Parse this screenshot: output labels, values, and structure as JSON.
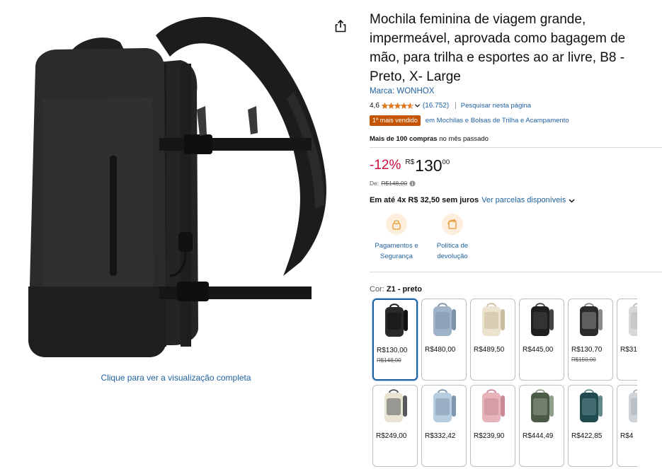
{
  "product": {
    "title": "Mochila feminina de viagem grande, impermeável, aprovada como bagagem de mão, para trilha e esportes ao ar livre, B8 - Preto, X- Large",
    "brand": "Marca: WONHOX",
    "image_alt": "Mochila de viagem preta",
    "view_full": "Clique para ver a visualização completa"
  },
  "rating": {
    "value": "4,6",
    "stars": 4.6,
    "count": "(16.752)",
    "separator": "|",
    "search_page": "Pesquisar nesta página"
  },
  "bestseller": {
    "badge": "1º mais vendido",
    "category": "em Mochilas e Bolsas de Trilha e Acampamento"
  },
  "bought": {
    "bold": "Mais de 100 compras",
    "rest": " no mês passado"
  },
  "price": {
    "discount": "-12%",
    "currency": "R$",
    "whole": "130",
    "cents": "00",
    "list_label": "De:",
    "list_price": "R$148,00"
  },
  "installments": {
    "bold": "Em até 4x R$ 32,50 sem juros",
    "link": "Ver parcelas disponíveis"
  },
  "features": [
    {
      "line1": "Pagamentos e",
      "line2": "Segurança"
    },
    {
      "line1": "Política de",
      "line2": "devolução"
    }
  ],
  "color": {
    "key": "Cor: ",
    "value": "Z1 - preto"
  },
  "swatches": [
    {
      "price": "R$130,00",
      "old": "R$148,00",
      "bag": "#2a2a2a",
      "trim": "#111111"
    },
    {
      "price": "R$480,00",
      "old": "",
      "bag": "#9fb4c8",
      "trim": "#7d93a8"
    },
    {
      "price": "R$489,50",
      "old": "",
      "bag": "#ece3cf",
      "trim": "#cbbd9f"
    },
    {
      "price": "R$445,00",
      "old": "",
      "bag": "#1f1f1f",
      "trim": "#444444"
    },
    {
      "price": "R$130,70",
      "old": "R$150,00",
      "bag": "#2b2b2b",
      "trim": "#8a8a8a"
    },
    {
      "price": "R$31",
      "old": "",
      "bag": "#d8d8d8",
      "trim": "#bcbcbc"
    },
    {
      "price": "R$249,00",
      "old": "",
      "bag": "#e9e4d4",
      "trim": "#55595c"
    },
    {
      "price": "R$332,42",
      "old": "",
      "bag": "#b7cde0",
      "trim": "#7f98ad"
    },
    {
      "price": "R$239,90",
      "old": "",
      "bag": "#e8b4bc",
      "trim": "#c98a95"
    },
    {
      "price": "R$444,49",
      "old": "",
      "bag": "#4c5a48",
      "trim": "#8fa08a"
    },
    {
      "price": "R$422,85",
      "old": "",
      "bag": "#1f4a4e",
      "trim": "#63878a"
    },
    {
      "price": "R$4",
      "old": "",
      "bag": "#cfd4d8",
      "trim": "#aab1b6"
    }
  ],
  "colors": {
    "link": "#2162a1",
    "badge": "#c45500",
    "discount": "#cc0c39",
    "star": "#de7921",
    "selected_border": "#2162a1"
  }
}
